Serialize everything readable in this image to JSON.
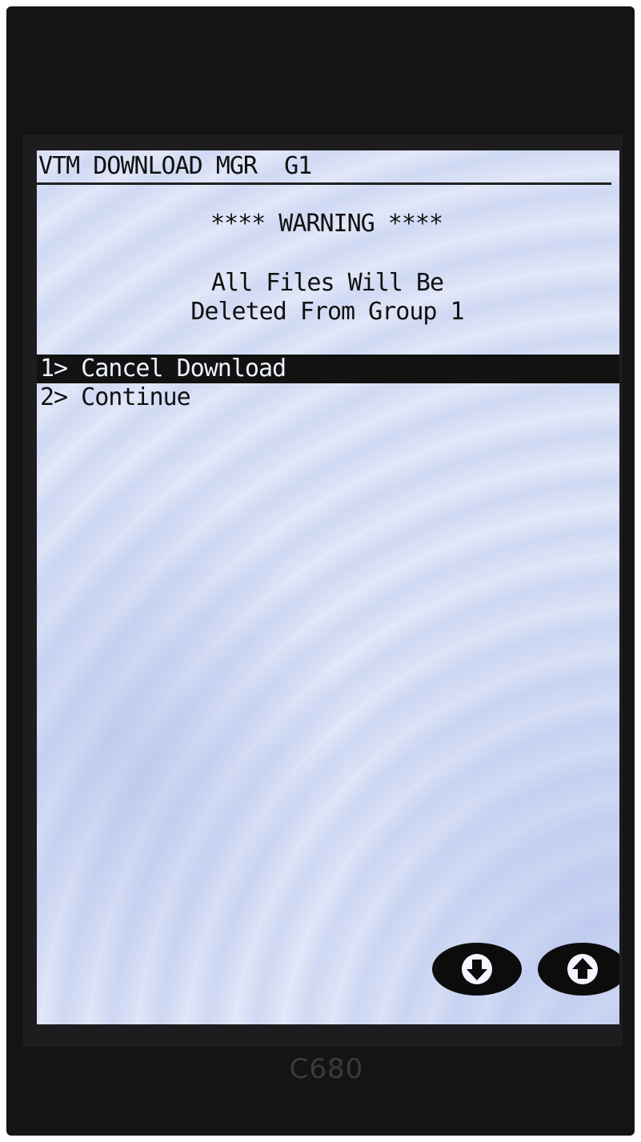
{
  "header": {
    "title": "VTM DOWNLOAD MGR  G1"
  },
  "dialog": {
    "warning": "**** WARNING ****",
    "message_line1": "All Files Will Be",
    "message_line2": "Deleted From Group 1"
  },
  "menu": {
    "items": [
      {
        "label": "1> Cancel Download",
        "selected": true
      },
      {
        "label": "2> Continue",
        "selected": false
      }
    ]
  },
  "nav": {
    "down_icon": "arrow-down-icon",
    "up_icon": "arrow-up-icon"
  },
  "device": {
    "model": "C680"
  },
  "colors": {
    "screen_bg": "#dde3f6",
    "highlight_bg": "#121212",
    "highlight_text": "#eef2ff",
    "bezel": "#141414"
  }
}
